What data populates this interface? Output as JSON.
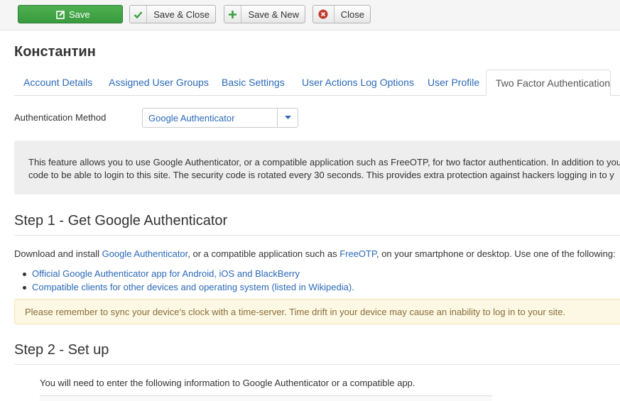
{
  "toolbar": {
    "save_label": "Save",
    "save_close_label": "Save & Close",
    "save_new_label": "Save & New",
    "close_label": "Close"
  },
  "page_title": "Константин",
  "tabs": [
    {
      "label": "Account Details"
    },
    {
      "label": "Assigned User Groups"
    },
    {
      "label": "Basic Settings"
    },
    {
      "label": "User Actions Log Options"
    },
    {
      "label": "User Profile"
    },
    {
      "label": "Two Factor Authentication",
      "active": true
    }
  ],
  "method": {
    "label": "Authentication Method",
    "selected": "Google Authenticator"
  },
  "info": {
    "line1": "This feature allows you to use Google Authenticator, or a compatible application such as FreeOTP, for two factor authentication. In addition to you",
    "line2": "code to be able to login to this site. The security code is rotated every 30 seconds. This provides extra protection against hackers logging in to y"
  },
  "step1": {
    "heading": "Step 1 - Get Google Authenticator",
    "desc_prefix": "Download and install ",
    "desc_link1": "Google Authenticator",
    "desc_mid": ", or a compatible application such as ",
    "desc_link2": "FreeOTP",
    "desc_suffix": ", on your smartphone or desktop. Use one of the following:",
    "links": [
      {
        "label": "Official Google Authenticator app for Android, iOS and BlackBerry"
      },
      {
        "label": "Compatible clients for other devices and operating system (listed in Wikipedia)."
      }
    ],
    "warning": "Please remember to sync your device's clock with a time-server. Time drift in your device may cause an inability to log in to your site."
  },
  "step2": {
    "heading": "Step 2 - Set up",
    "instruction": "You will need to enter the following information to Google Authenticator or a compatible app."
  },
  "colors": {
    "accent_link": "#2a69b8",
    "save_green": "#3e9f42",
    "close_red": "#c0392b",
    "warning_bg": "#fcf8e3"
  },
  "icons": {
    "save": "edit-icon",
    "save_close": "check-icon",
    "save_new": "plus-icon",
    "close": "close-circle-icon",
    "dropdown": "caret-down-icon"
  }
}
